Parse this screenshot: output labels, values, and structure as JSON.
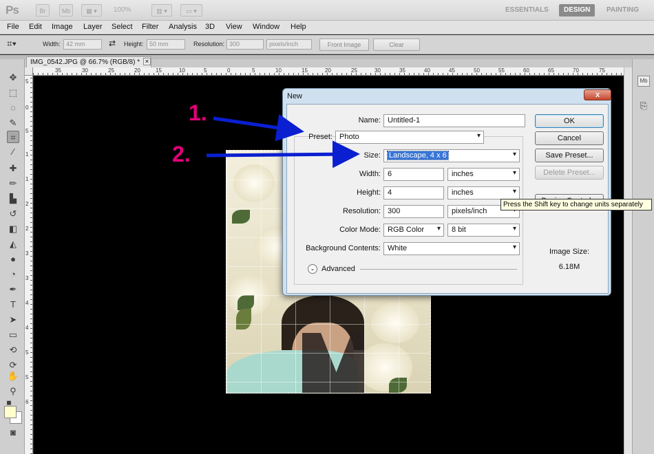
{
  "app": {
    "logo": "Ps",
    "zoom": "100%",
    "bridge_label": "Br",
    "minibridge_label": "Mb",
    "workspaces": [
      "ESSENTIALS",
      "DESIGN",
      "PAINTING"
    ],
    "active_workspace": "DESIGN"
  },
  "menu": [
    "File",
    "Edit",
    "Image",
    "Layer",
    "Select",
    "Filter",
    "Analysis",
    "3D",
    "View",
    "Window",
    "Help"
  ],
  "options": {
    "width_label": "Width:",
    "width_value": "42 mm",
    "height_label": "Height:",
    "height_value": "50 mm",
    "resolution_label": "Resolution:",
    "resolution_value": "300",
    "resolution_unit": "pixels/inch",
    "front_image": "Front Image",
    "clear": "Clear"
  },
  "document": {
    "tab_title": "IMG_0542.JPG @ 66.7% (RGB/8) *",
    "close": "✕",
    "hruler_ticks": [
      "35",
      "30",
      "25",
      "20",
      "15",
      "10",
      "5",
      "0",
      "5",
      "10",
      "15",
      "20",
      "25",
      "30",
      "35",
      "40",
      "45",
      "50",
      "55",
      "60",
      "65",
      "70",
      "75"
    ],
    "vruler_ticks": [
      "5",
      "0",
      "5",
      "1",
      "1",
      "2",
      "2",
      "3",
      "3",
      "4",
      "4",
      "5",
      "5",
      "6"
    ]
  },
  "dialog": {
    "title": "New",
    "close": "x",
    "name_label": "Name:",
    "name_value": "Untitled-1",
    "preset_label": "Preset:",
    "preset_value": "Photo",
    "size_label": "Size:",
    "size_value": "Landscape, 4 x 6",
    "width_label": "Width:",
    "width_value": "6",
    "width_unit": "inches",
    "height_label": "Height:",
    "height_value": "4",
    "height_unit": "inches",
    "resolution_label": "Resolution:",
    "resolution_value": "300",
    "resolution_unit": "pixels/inch",
    "color_mode_label": "Color Mode:",
    "color_mode_value": "RGB Color",
    "bit_depth": "8 bit",
    "background_label": "Background Contents:",
    "background_value": "White",
    "advanced_label": "Advanced",
    "buttons": {
      "ok": "OK",
      "cancel": "Cancel",
      "save_preset": "Save Preset...",
      "delete_preset": "Delete Preset...",
      "device_central": "Device Central..."
    },
    "image_size_label": "Image Size:",
    "image_size_value": "6.18M",
    "tooltip": "Press the Shift key to change units separately"
  },
  "annotations": {
    "step1": "1.",
    "step2": "2."
  },
  "colors": {
    "annotation": "#e1007a",
    "arrow": "#0a1fd0",
    "highlight": "#3875d7"
  }
}
